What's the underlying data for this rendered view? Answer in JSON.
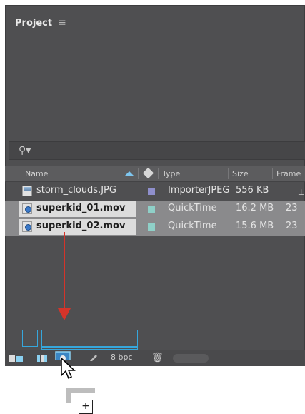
{
  "panel": {
    "title": "Project",
    "menu_icon": "hamburger-menu-icon"
  },
  "search": {
    "icon": "search-dropdown-icon",
    "placeholder": ""
  },
  "columns": {
    "name": "Name",
    "type": "Type",
    "size": "Size",
    "frame": "Frame"
  },
  "rows": [
    {
      "name": "storm_clouds.JPG",
      "type": "ImporterJPEG",
      "size": "556 KB",
      "frame": "",
      "label_color": "#8f8fcc",
      "selected": false
    },
    {
      "name": "superkid_01.mov",
      "type": "QuickTime",
      "size": "16.2 MB",
      "frame": "23",
      "label_color": "#8fd0c8",
      "selected": true
    },
    {
      "name": "superkid_02.mov",
      "type": "QuickTime",
      "size": "15.6 MB",
      "frame": "23",
      "label_color": "#8fd0c8",
      "selected": true
    }
  ],
  "footer": {
    "bpc": "8 bpc"
  },
  "colors": {
    "accent_blue": "#36a7dc",
    "drag_arrow": "#d4342a",
    "panel_bg": "#4f4f51"
  }
}
